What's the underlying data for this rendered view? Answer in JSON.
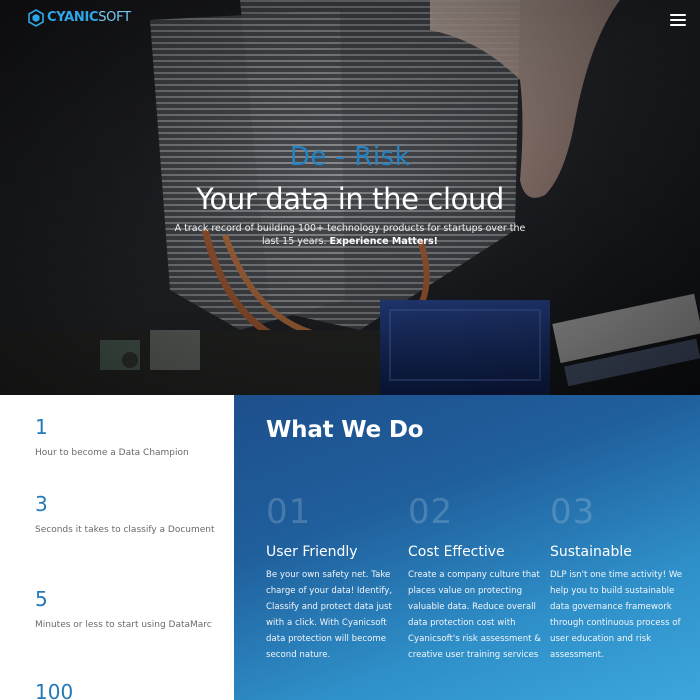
{
  "header": {
    "logo_brand": "CYANIC",
    "logo_soft": "SOFT",
    "menu_icon": "hamburger-menu-icon"
  },
  "hero": {
    "kicker": "De - Risk",
    "title": "Your data in the cloud",
    "subtitle_text": "A track record of building 100+ technology products for startups over the last 15 years.",
    "subtitle_emphasis": "Experience Matters!"
  },
  "stats": [
    {
      "number": "1",
      "label": "Hour to become a Data Champion"
    },
    {
      "number": "3",
      "label": "Seconds it takes to classify a Document"
    },
    {
      "number": "5",
      "label": "Minutes or less to start using DataMarc"
    },
    {
      "number": "100",
      "label": ""
    }
  ],
  "services": {
    "title": "What We Do",
    "items": [
      {
        "number": "01",
        "title": "User Friendly",
        "text": "Be your own safety net. Take charge of your data! Identify, Classify and protect data just with a click. With Cyanicsoft data protection will become second nature."
      },
      {
        "number": "02",
        "title": "Cost Effective",
        "text": "Create a company culture that places value on protecting valuable data. Reduce overall data protection cost with Cyanicsoft's risk assessment & creative user training services"
      },
      {
        "number": "03",
        "title": "Sustainable",
        "text": "DLP isn't one time activity! We help you to build sustainable data governance framework through continuous process of user education and risk assessment."
      }
    ]
  },
  "colors": {
    "accent": "#2283c6",
    "services_gradient_start": "#1e4f8c",
    "services_gradient_end": "#3ca6dd",
    "stat_number": "#2479b8"
  }
}
